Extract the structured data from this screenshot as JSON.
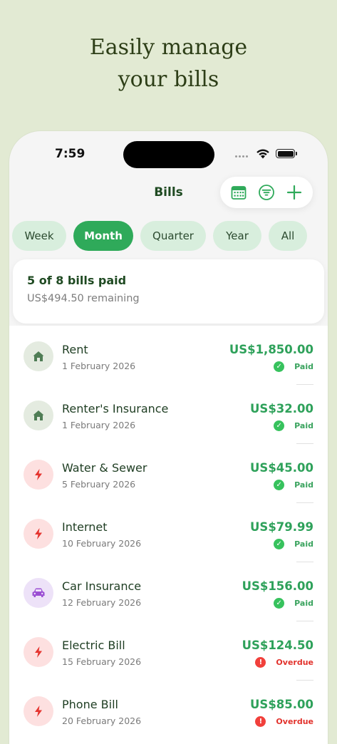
{
  "headline": {
    "line1": "Easily manage",
    "line2": "your bills"
  },
  "status_bar": {
    "time": "7:59"
  },
  "nav": {
    "title": "Bills"
  },
  "toolbar": {
    "icons": [
      "calendar-icon",
      "filter-icon",
      "plus-icon"
    ]
  },
  "filters": {
    "selected": "Month",
    "items": [
      {
        "label": "Week"
      },
      {
        "label": "Month"
      },
      {
        "label": "Quarter"
      },
      {
        "label": "Year"
      },
      {
        "label": "All"
      }
    ]
  },
  "summary": {
    "title": "5 of 8 bills paid",
    "remaining": "US$494.50 remaining"
  },
  "bills": [
    {
      "name": "Rent",
      "date": "1 February 2026",
      "amount": "US$1,850.00",
      "status": "Paid",
      "icon": "home-icon"
    },
    {
      "name": "Renter's Insurance",
      "date": "1 February 2026",
      "amount": "US$32.00",
      "status": "Paid",
      "icon": "home-icon"
    },
    {
      "name": "Water & Sewer",
      "date": "5 February 2026",
      "amount": "US$45.00",
      "status": "Paid",
      "icon": "bolt-icon"
    },
    {
      "name": "Internet",
      "date": "10 February 2026",
      "amount": "US$79.99",
      "status": "Paid",
      "icon": "bolt-icon"
    },
    {
      "name": "Car Insurance",
      "date": "12 February 2026",
      "amount": "US$156.00",
      "status": "Paid",
      "icon": "car-icon"
    },
    {
      "name": "Electric Bill",
      "date": "15 February 2026",
      "amount": "US$124.50",
      "status": "Overdue",
      "icon": "bolt-icon"
    },
    {
      "name": "Phone Bill",
      "date": "20 February 2026",
      "amount": "US$85.00",
      "status": "Overdue",
      "icon": "bolt-icon"
    }
  ],
  "colors": {
    "accent": "#2faa5a",
    "background": "#e2ead3",
    "paid": "#37c25d",
    "overdue": "#f1403b"
  }
}
